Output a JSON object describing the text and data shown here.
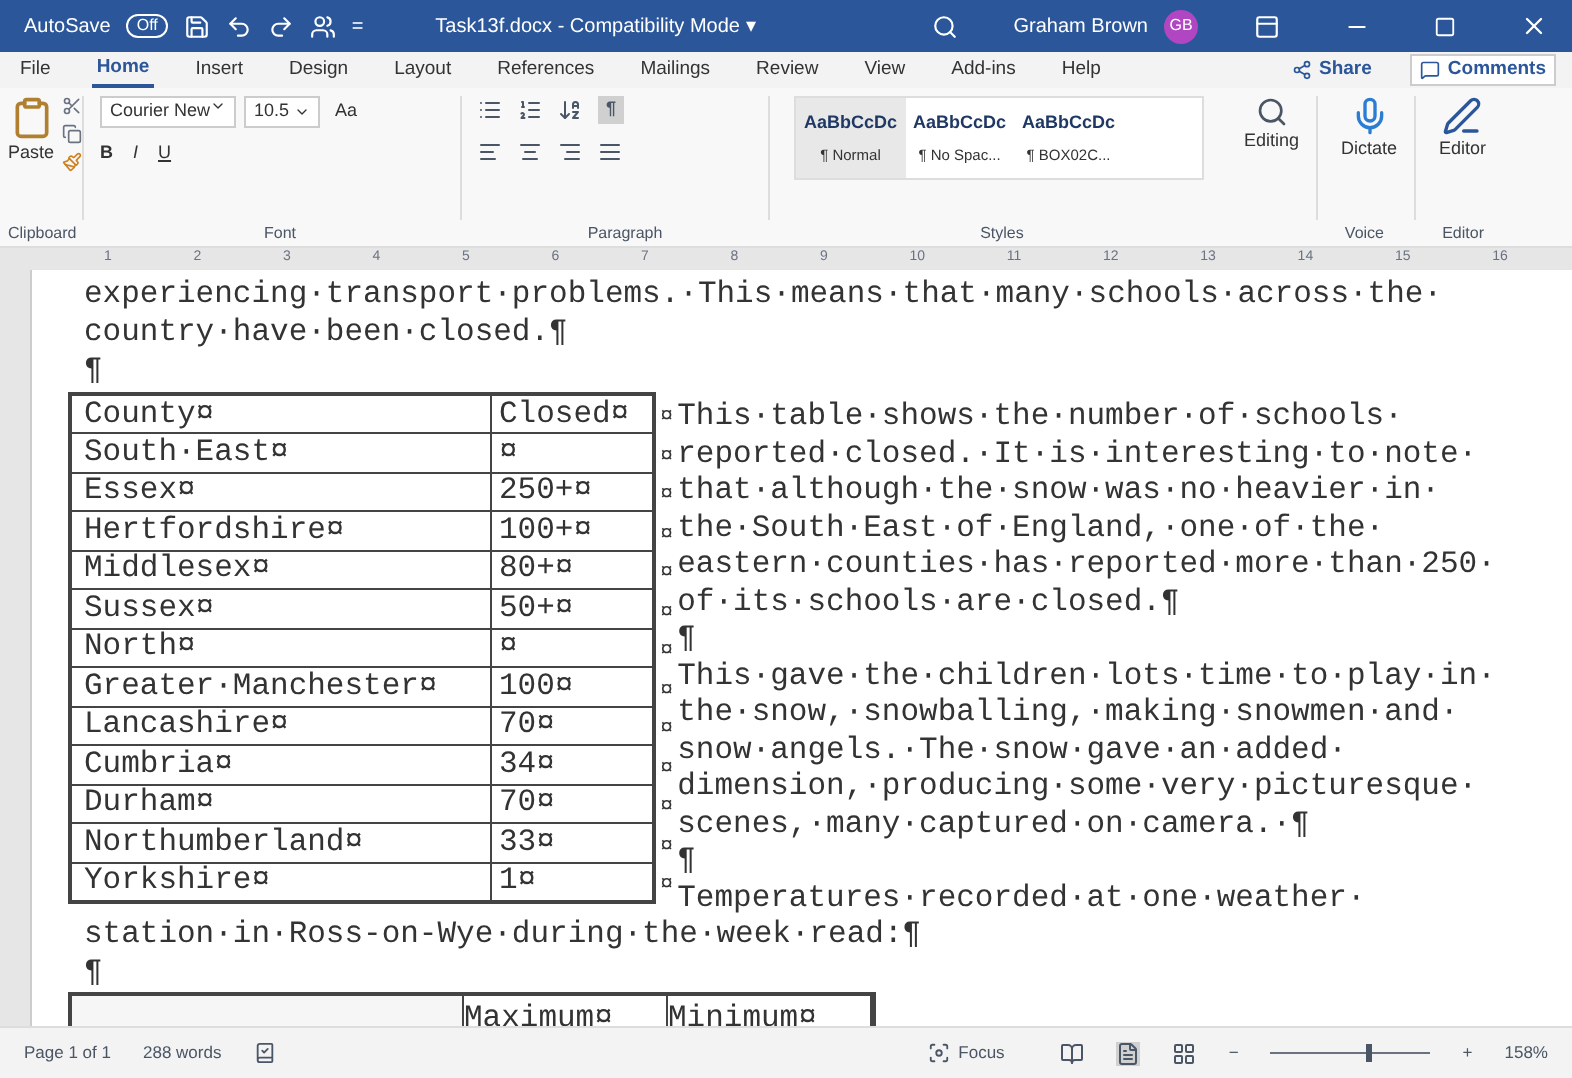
{
  "title_bar": {
    "autosave_label": "AutoSave",
    "autosave_toggle": {
      "label": "Off",
      "on": false
    },
    "customize": "=",
    "document_title": "Task13f.docx - Compatibility Mode",
    "title_caret": "▾",
    "user_name": "Graham Brown",
    "avatar": "GB"
  },
  "ribbon_tabs": [
    {
      "label": "File",
      "selected": false
    },
    {
      "label": "Home",
      "selected": true
    },
    {
      "label": "Insert",
      "selected": false
    },
    {
      "label": "Design",
      "selected": false
    },
    {
      "label": "Layout",
      "selected": false
    },
    {
      "label": "References",
      "selected": false
    },
    {
      "label": "Mailings",
      "selected": false
    },
    {
      "label": "Review",
      "selected": false
    },
    {
      "label": "View",
      "selected": false
    },
    {
      "label": "Add-ins",
      "selected": false
    },
    {
      "label": "Help",
      "selected": false
    }
  ],
  "share_button": "Share",
  "comments_button": "Comments",
  "ribbon": {
    "paste": "Paste",
    "font_name": "Courier New",
    "font_size": "10.5",
    "format_buttons": [
      "B",
      "I",
      "U"
    ],
    "aa_button": "Aa",
    "show_marks": {
      "label": "¶",
      "on": true
    },
    "styles": [
      {
        "preview": "AaBbCcDc",
        "name": "¶ Normal",
        "selected": true
      },
      {
        "preview": "AaBbCcDc",
        "name": "¶ No Spac...",
        "selected": false
      },
      {
        "preview": "AaBbCcDc",
        "name": "¶ BOX02C...",
        "selected": false
      }
    ],
    "editing": "Editing",
    "dictate": "Dictate",
    "editor": "Editor",
    "group_labels": [
      "Clipboard",
      "Font",
      "Paragraph",
      "Styles",
      "Voice",
      "Editor"
    ]
  },
  "ruler_numbers": [
    "1",
    "2",
    "3",
    "4",
    "5",
    "6",
    "7",
    "8",
    "9",
    "10",
    "11",
    "12",
    "13",
    "14",
    "15",
    "16"
  ],
  "document": {
    "intro_lines": [
      "experiencing·transport·problems.·This·means·that·many·schools·across·the·",
      "country·have·been·closed.¶",
      "¶"
    ],
    "table": {
      "rows": [
        {
          "county": "County¤",
          "closed": "Closed¤",
          "end_mark": "¤"
        },
        {
          "county": "South·East¤",
          "closed": "¤",
          "end_mark": "¤"
        },
        {
          "county": "Essex¤",
          "closed": "250+¤",
          "end_mark": "¤"
        },
        {
          "county": "Hertfordshire¤",
          "closed": "100+¤",
          "end_mark": "¤"
        },
        {
          "county": "Middlesex¤",
          "closed": "80+¤",
          "end_mark": "¤"
        },
        {
          "county": "Sussex¤",
          "closed": "50+¤",
          "end_mark": "¤"
        },
        {
          "county": "North¤",
          "closed": "¤",
          "end_mark": "¤"
        },
        {
          "county": "Greater·Manchester¤",
          "closed": "100¤",
          "end_mark": "¤"
        },
        {
          "county": "Lancashire¤",
          "closed": "70¤",
          "end_mark": "¤"
        },
        {
          "county": "Cumbria¤",
          "closed": "34¤",
          "end_mark": "¤"
        },
        {
          "county": "Durham¤",
          "closed": "70¤",
          "end_mark": "¤"
        },
        {
          "county": "Northumberland¤",
          "closed": "33¤",
          "end_mark": "¤"
        },
        {
          "county": "Yorkshire¤",
          "closed": "1¤",
          "end_mark": "¤"
        }
      ]
    },
    "side_lines": [
      "This·table·shows·the·number·of·schools·",
      "reported·closed.·It·is·interesting·to·note·",
      "that·although·the·snow·was·no·heavier·in·",
      "the·South·East·of·England,·one·of·the·",
      "eastern·counties·has·reported·more·than·250·",
      "of·its·schools·are·closed.¶",
      "¶",
      "This·gave·the·children·lots·time·to·play·in·",
      "the·snow,·snowballing,·making·snowmen·and·",
      "snow·angels.·The·snow·gave·an·added·",
      "dimension,·producing·some·very·picturesque·",
      "scenes,·many·captured·on·camera.·¶",
      "¶",
      "Temperatures·recorded·at·one·weather·"
    ],
    "after_lines": [
      "station·in·Ross-on-Wye·during·the·week·read:¶",
      "¶"
    ],
    "temperature_table_headers": [
      "Maximum¤",
      "Minimum¤"
    ]
  },
  "status_bar": {
    "page": "Page 1 of 1",
    "words": "288 words",
    "focus": "Focus",
    "zoom_minus": "−",
    "zoom_plus": "+",
    "zoom": "158%",
    "zoom_slider": {
      "level": 0.6
    }
  }
}
